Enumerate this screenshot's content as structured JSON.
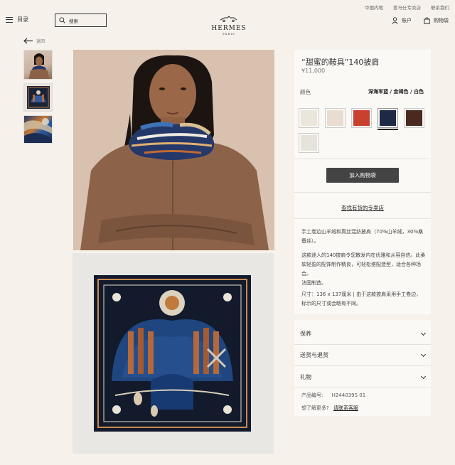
{
  "top_links": [
    "中国内地",
    "爱马仕专卖店",
    "联系我们"
  ],
  "header": {
    "menu_label": "目录",
    "search_placeholder": "搜索",
    "logo": "HERMES",
    "logo_sub": "PARIS",
    "account_label": "账户",
    "bag_label": "购物袋"
  },
  "back_label": "返回",
  "product": {
    "title": "“甜蜜的鞍具”140披肩",
    "price": "¥11,000",
    "color_label": "颜色",
    "color_name": "深海军蓝 / 金褐色 / 白色",
    "swatch_colors": [
      "#ebe6dc",
      "#e8ddd0",
      "#c9402e",
      "#1e2a45",
      "#4a2a1e",
      "#e6e3dc"
    ],
    "add_to_cart": "加入购物袋",
    "find_store": "查找有货的专卖店",
    "desc": [
      "手工卷边山羊绒和真丝混纺披肩（70%山羊绒，30%桑蚕丝）。",
      "这款迷人的140披肩令您散发内在优雅和从容自信。此柔软轻盈的配饰制作精良，可轻松搭配造型，适合各种场合。",
      "法国制造。",
      "尺寸：136 x 137厘米 | 由于这款披肩采用手工卷边，标示的尺寸或会略有不同。"
    ]
  },
  "accordion": [
    "保养",
    "送货与退货",
    "礼物"
  ],
  "product_number_label": "产品编号:",
  "product_number": "H244039S 01",
  "more_question": "想了解更多?",
  "contact_link": "请联系客服"
}
